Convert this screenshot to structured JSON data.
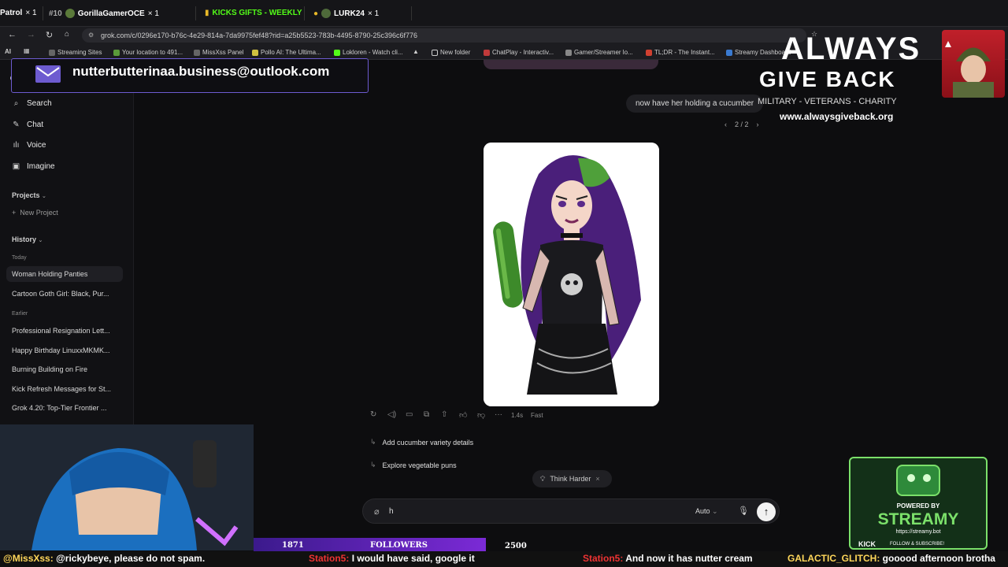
{
  "topbar": {
    "items": [
      {
        "label": "Patrol",
        "suffix": "× 1"
      },
      {
        "label": "#10",
        "name": "GorillaGamerOCE",
        "suffix": "× 1"
      },
      {
        "label": "KICKS GIFTS - WEEKLY"
      },
      {
        "label": "LURK24",
        "suffix": "× 1"
      }
    ]
  },
  "browser": {
    "url": "grok.com/c/0296e170-b76c-4e29-814a-7da9975fef48?rid=a25b5523-783b-4495-8790-25c396c6f776",
    "bookmarks": [
      "Streaming Sites",
      "Your location to 491...",
      "MissXss Panel",
      "Pollo AI: The Ultima...",
      "Lokloren - Watch cli...",
      "New folder",
      "ChatPlay - Interactiv...",
      "Gamer/Streamer lo...",
      "TL;DR - The Instant...",
      "Streamy Dashboard"
    ]
  },
  "email_banner": {
    "text": "nutterbutterinaa.business@outlook.com"
  },
  "sidebar": {
    "nav": [
      {
        "label": "Search",
        "icon": "search-icon"
      },
      {
        "label": "Chat",
        "icon": "chat-icon"
      },
      {
        "label": "Voice",
        "icon": "voice-icon"
      },
      {
        "label": "Imagine",
        "icon": "image-icon"
      }
    ],
    "projects_label": "Projects",
    "new_project": "New Project",
    "history_label": "History",
    "today_label": "Today",
    "today": [
      "Woman Holding Panties",
      "Cartoon Goth Girl: Black, Pur..."
    ],
    "earlier_label": "Earlier",
    "earlier": [
      "Professional Resignation Lett...",
      "Happy Birthday LinuxxMKMK...",
      "Burning Building on Fire",
      "Kick Refresh Messages for St...",
      "Grok 4.20: Top-Tier Frontier ..."
    ]
  },
  "chat": {
    "user_message": "now have her holding a cucumber",
    "pager": "2 / 2",
    "meta_time": "1.4s",
    "meta_mode": "Fast",
    "suggestions": [
      "Add cucumber variety details",
      "Explore vegetable puns"
    ],
    "think_harder": "Think Harder",
    "composer_value": "h",
    "mode": "Auto"
  },
  "overlays": {
    "agb_line1": "ALWAYS",
    "agb_line2": "GIVE BACK",
    "agb_tag": "MILITARY - VETERANS - CHARITY",
    "agb_url": "www.alwaysgiveback.org",
    "followers_current": "1871",
    "followers_label": "FOLLOWERS",
    "followers_goal": "2500",
    "streamy_powered": "POWERED BY",
    "streamy_name": "STREAMY",
    "streamy_url": "https://streamy.bot",
    "streamy_kick": "KICK",
    "streamy_follow": "FOLLOW & SUBSCRIBE!",
    "ticker": [
      {
        "user": "@MissXss:",
        "text": "@rickybeye, please do not spam."
      },
      {
        "user": "Station5:",
        "text": "I would have said, google it"
      },
      {
        "user": "Station5:",
        "text": "And now it has nutter cream"
      },
      {
        "user": "GALACTIC_GLITCH:",
        "text": "gooood afternoon brotha"
      }
    ]
  }
}
